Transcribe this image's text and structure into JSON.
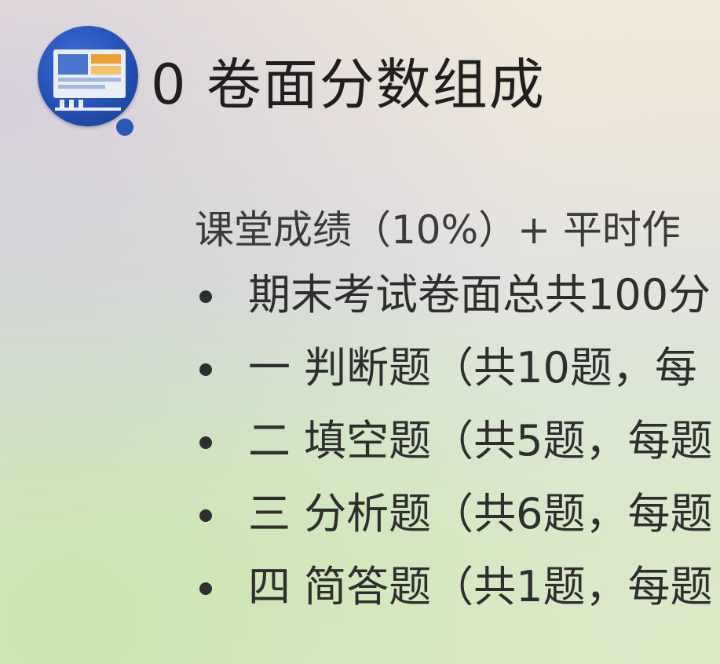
{
  "slide": {
    "header": {
      "icon": "presentation-monitor-icon",
      "title": "0 卷面分数组成"
    },
    "formula_text": "课堂成绩（10%）+ 平时作",
    "bullets": [
      "期末考试卷面总共100分",
      "一 判断题（共10题，每",
      "二 填空题（共5题，每题",
      "三 分析题（共6题，每题",
      "四 简答题（共1题，每题"
    ],
    "colors": {
      "logo_blue": "#2451b3",
      "logo_orange": "#f0a030",
      "text_dark": "#2e2e2e"
    }
  }
}
